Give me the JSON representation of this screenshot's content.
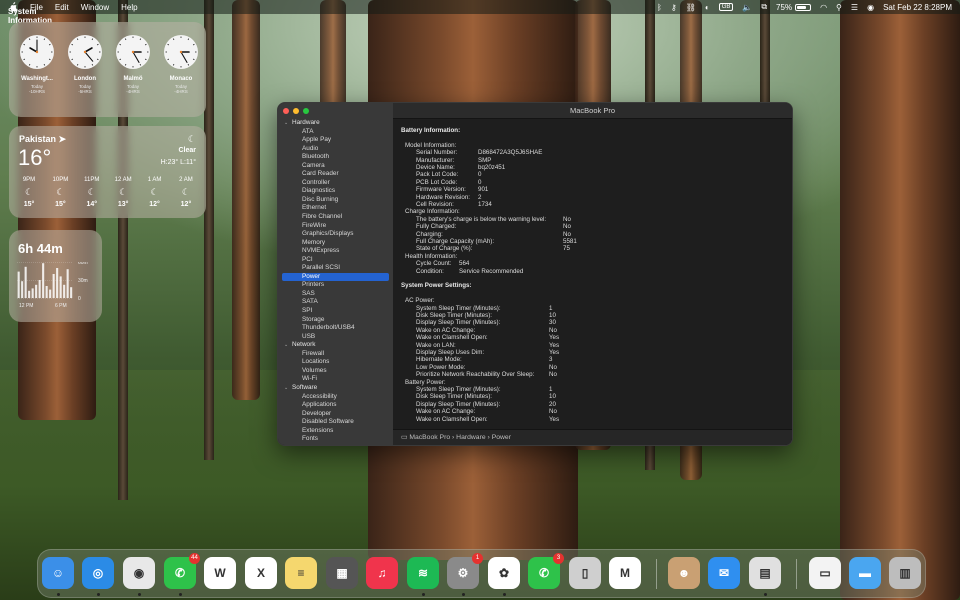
{
  "menubar": {
    "app_name": "System Information",
    "menus": [
      "File",
      "Edit",
      "Window",
      "Help"
    ],
    "input_source": "GB",
    "battery_percent": "75%",
    "battery_level": 0.75,
    "datetime": "Sat Feb 22  8:28PM"
  },
  "clocks": [
    {
      "city": "Washingt...",
      "day": "Today",
      "offset": "-10HRS"
    },
    {
      "city": "London",
      "day": "Today",
      "offset": "-5HRS"
    },
    {
      "city": "Malmö",
      "day": "Today",
      "offset": "-4HRS"
    },
    {
      "city": "Monaco",
      "day": "Today",
      "offset": "-4HRS"
    }
  ],
  "weather": {
    "location": "Pakistan",
    "temperature": "16°",
    "condition": "Clear",
    "hilo": "H:23° L:11°",
    "hours": [
      {
        "time": "9PM",
        "temp": "15°"
      },
      {
        "time": "10PM",
        "temp": "15°"
      },
      {
        "time": "11PM",
        "temp": "14°"
      },
      {
        "time": "12 AM",
        "temp": "13°"
      },
      {
        "time": "1 AM",
        "temp": "12°"
      },
      {
        "time": "2 AM",
        "temp": "12°"
      }
    ]
  },
  "screen_time": {
    "total": "6h 44m",
    "y_labels": [
      "60m",
      "30m",
      "0"
    ],
    "x_labels": [
      "12 PM",
      "6 PM"
    ],
    "bar_minutes": [
      44,
      28,
      52,
      12,
      16,
      22,
      30,
      58,
      20,
      14,
      40,
      50,
      36,
      22,
      48,
      18
    ]
  },
  "window": {
    "title": "MacBook Pro",
    "sidebar": [
      {
        "type": "group",
        "label": "Hardware"
      },
      {
        "type": "item",
        "label": "ATA"
      },
      {
        "type": "item",
        "label": "Apple Pay"
      },
      {
        "type": "item",
        "label": "Audio"
      },
      {
        "type": "item",
        "label": "Bluetooth"
      },
      {
        "type": "item",
        "label": "Camera"
      },
      {
        "type": "item",
        "label": "Card Reader"
      },
      {
        "type": "item",
        "label": "Controller"
      },
      {
        "type": "item",
        "label": "Diagnostics"
      },
      {
        "type": "item",
        "label": "Disc Burning"
      },
      {
        "type": "item",
        "label": "Ethernet"
      },
      {
        "type": "item",
        "label": "Fibre Channel"
      },
      {
        "type": "item",
        "label": "FireWire"
      },
      {
        "type": "item",
        "label": "Graphics/Displays"
      },
      {
        "type": "item",
        "label": "Memory"
      },
      {
        "type": "item",
        "label": "NVMExpress"
      },
      {
        "type": "item",
        "label": "PCI"
      },
      {
        "type": "item",
        "label": "Parallel SCSI"
      },
      {
        "type": "item",
        "label": "Power",
        "selected": true
      },
      {
        "type": "item",
        "label": "Printers"
      },
      {
        "type": "item",
        "label": "SAS"
      },
      {
        "type": "item",
        "label": "SATA"
      },
      {
        "type": "item",
        "label": "SPI"
      },
      {
        "type": "item",
        "label": "Storage"
      },
      {
        "type": "item",
        "label": "Thunderbolt/USB4"
      },
      {
        "type": "item",
        "label": "USB"
      },
      {
        "type": "group",
        "label": "Network"
      },
      {
        "type": "item",
        "label": "Firewall"
      },
      {
        "type": "item",
        "label": "Locations"
      },
      {
        "type": "item",
        "label": "Volumes"
      },
      {
        "type": "item",
        "label": "Wi-Fi"
      },
      {
        "type": "group",
        "label": "Software"
      },
      {
        "type": "item",
        "label": "Accessibility"
      },
      {
        "type": "item",
        "label": "Applications"
      },
      {
        "type": "item",
        "label": "Developer"
      },
      {
        "type": "item",
        "label": "Disabled Software"
      },
      {
        "type": "item",
        "label": "Extensions"
      },
      {
        "type": "item",
        "label": "Fonts"
      }
    ],
    "battery_title": "Battery Information:",
    "battery_rows": [
      {
        "level": 1,
        "key": "Model Information:",
        "value": ""
      },
      {
        "level": 2,
        "key": "Serial Number:",
        "value": "D868472A3Q5J6SHAE"
      },
      {
        "level": 2,
        "key": "Manufacturer:",
        "value": "SMP"
      },
      {
        "level": 2,
        "key": "Device Name:",
        "value": "bq20z451"
      },
      {
        "level": 2,
        "key": "Pack Lot Code:",
        "value": "0"
      },
      {
        "level": 2,
        "key": "PCB Lot Code:",
        "value": "0"
      },
      {
        "level": 2,
        "key": "Firmware Version:",
        "value": "901"
      },
      {
        "level": 2,
        "key": "Hardware Revision:",
        "value": "2"
      },
      {
        "level": 2,
        "key": "Cell Revision:",
        "value": "1734"
      },
      {
        "level": 1,
        "key": "Charge Information:",
        "value": ""
      },
      {
        "level": 2,
        "key": "The battery's charge is below the warning level:",
        "value": "No"
      },
      {
        "level": 2,
        "key": "Fully Charged:",
        "value": "No"
      },
      {
        "level": 2,
        "key": "Charging:",
        "value": "No"
      },
      {
        "level": 2,
        "key": "Full Charge Capacity (mAh):",
        "value": "5581"
      },
      {
        "level": 2,
        "key": "State of Charge (%):",
        "value": "75"
      },
      {
        "level": 1,
        "key": "Health Information:",
        "value": ""
      },
      {
        "level": 2,
        "key": "Cycle Count:",
        "value": "564",
        "short": true
      },
      {
        "level": 2,
        "key": "Condition:",
        "value": "Service Recommended",
        "short": true
      }
    ],
    "power_title": "System Power Settings:",
    "power_rows": [
      {
        "level": 1,
        "key": "AC Power:",
        "value": ""
      },
      {
        "level": 2,
        "key": "System Sleep Timer (Minutes):",
        "value": "1"
      },
      {
        "level": 2,
        "key": "Disk Sleep Timer (Minutes):",
        "value": "10"
      },
      {
        "level": 2,
        "key": "Display Sleep Timer (Minutes):",
        "value": "30"
      },
      {
        "level": 2,
        "key": "Wake on AC Change:",
        "value": "No"
      },
      {
        "level": 2,
        "key": "Wake on Clamshell Open:",
        "value": "Yes"
      },
      {
        "level": 2,
        "key": "Wake on LAN:",
        "value": "Yes"
      },
      {
        "level": 2,
        "key": "Display Sleep Uses Dim:",
        "value": "Yes"
      },
      {
        "level": 2,
        "key": "Hibernate Mode:",
        "value": "3"
      },
      {
        "level": 2,
        "key": "Low Power Mode:",
        "value": "No"
      },
      {
        "level": 2,
        "key": "Prioritize Network Reachability Over Sleep:",
        "value": "No"
      },
      {
        "level": 1,
        "key": "Battery Power:",
        "value": ""
      },
      {
        "level": 2,
        "key": "System Sleep Timer (Minutes):",
        "value": "1"
      },
      {
        "level": 2,
        "key": "Disk Sleep Timer (Minutes):",
        "value": "10"
      },
      {
        "level": 2,
        "key": "Display Sleep Timer (Minutes):",
        "value": "20"
      },
      {
        "level": 2,
        "key": "Wake on AC Change:",
        "value": "No"
      },
      {
        "level": 2,
        "key": "Wake on Clamshell Open:",
        "value": "Yes"
      }
    ],
    "path": [
      "MacBook Pro",
      "Hardware",
      "Power"
    ]
  },
  "dock": [
    {
      "name": "finder",
      "color": "#3b8fe8",
      "glyph": "☺",
      "running": true
    },
    {
      "name": "safari",
      "color": "#2b8be6",
      "glyph": "◎",
      "running": true
    },
    {
      "name": "chrome",
      "color": "#e8e8e8",
      "glyph": "◉",
      "running": true
    },
    {
      "name": "whatsapp",
      "color": "#2ec24a",
      "glyph": "✆",
      "running": true,
      "badge": "44"
    },
    {
      "name": "word",
      "color": "#ffffff",
      "glyph": "W",
      "running": false
    },
    {
      "name": "excel",
      "color": "#ffffff",
      "glyph": "X",
      "running": false
    },
    {
      "name": "notes",
      "color": "#f5d76e",
      "glyph": "≡",
      "running": false
    },
    {
      "name": "calculator",
      "color": "#555555",
      "glyph": "▦",
      "running": false
    },
    {
      "name": "music",
      "color": "#f0344c",
      "glyph": "♫",
      "running": false
    },
    {
      "name": "spotify",
      "color": "#1db954",
      "glyph": "≋",
      "running": true
    },
    {
      "name": "system-settings",
      "color": "#8a8a8a",
      "glyph": "⚙",
      "running": true,
      "badge": "1"
    },
    {
      "name": "chatgpt",
      "color": "#ffffff",
      "glyph": "✿",
      "running": true
    },
    {
      "name": "whatsapp-business",
      "color": "#2ec24a",
      "glyph": "✆",
      "running": false,
      "badge": "3"
    },
    {
      "name": "iphone-mirroring",
      "color": "#cfcfcf",
      "glyph": "▯",
      "running": false
    },
    {
      "name": "app-m",
      "color": "#ffffff",
      "glyph": "M",
      "running": false
    },
    {
      "name": "contacts",
      "color": "#c9a073",
      "glyph": "☻",
      "running": false
    },
    {
      "name": "mail",
      "color": "#2f8ff0",
      "glyph": "✉",
      "running": false
    },
    {
      "name": "system-information",
      "color": "#e0e0e0",
      "glyph": "▤",
      "running": true
    },
    {
      "name": "document",
      "color": "#f3f3f3",
      "glyph": "▭",
      "running": false
    },
    {
      "name": "folder",
      "color": "#4aa6f0",
      "glyph": "▬",
      "running": false
    },
    {
      "name": "trash",
      "color": "#bdbdbd",
      "glyph": "▥",
      "running": false
    }
  ]
}
